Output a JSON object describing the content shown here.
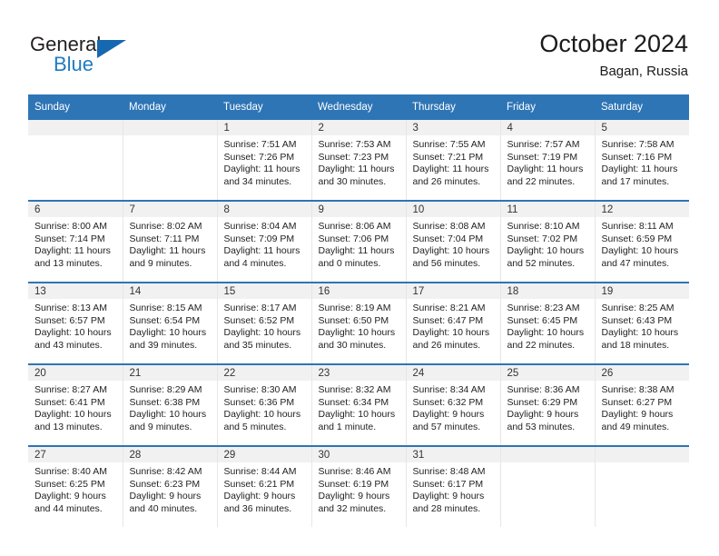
{
  "brand": {
    "name_top": "General",
    "name_bottom": "Blue",
    "accent_color": "#1668b0",
    "triangle_icon": "triangle-icon"
  },
  "header": {
    "title": "October 2024",
    "subtitle": "Bagan, Russia"
  },
  "theme": {
    "header_blue": "#2e75b6",
    "daynum_gray": "#f1f1f1",
    "text": "#222222"
  },
  "calendar": {
    "weekday_headers": [
      "Sunday",
      "Monday",
      "Tuesday",
      "Wednesday",
      "Thursday",
      "Friday",
      "Saturday"
    ],
    "labels": {
      "sunrise": "Sunrise:",
      "sunset": "Sunset:",
      "daylight": "Daylight:"
    },
    "weeks": [
      [
        {
          "day": "",
          "sunrise": "",
          "sunset": "",
          "daylight": ""
        },
        {
          "day": "",
          "sunrise": "",
          "sunset": "",
          "daylight": ""
        },
        {
          "day": "1",
          "sunrise": "Sunrise: 7:51 AM",
          "sunset": "Sunset: 7:26 PM",
          "daylight": "Daylight: 11 hours and 34 minutes."
        },
        {
          "day": "2",
          "sunrise": "Sunrise: 7:53 AM",
          "sunset": "Sunset: 7:23 PM",
          "daylight": "Daylight: 11 hours and 30 minutes."
        },
        {
          "day": "3",
          "sunrise": "Sunrise: 7:55 AM",
          "sunset": "Sunset: 7:21 PM",
          "daylight": "Daylight: 11 hours and 26 minutes."
        },
        {
          "day": "4",
          "sunrise": "Sunrise: 7:57 AM",
          "sunset": "Sunset: 7:19 PM",
          "daylight": "Daylight: 11 hours and 22 minutes."
        },
        {
          "day": "5",
          "sunrise": "Sunrise: 7:58 AM",
          "sunset": "Sunset: 7:16 PM",
          "daylight": "Daylight: 11 hours and 17 minutes."
        }
      ],
      [
        {
          "day": "6",
          "sunrise": "Sunrise: 8:00 AM",
          "sunset": "Sunset: 7:14 PM",
          "daylight": "Daylight: 11 hours and 13 minutes."
        },
        {
          "day": "7",
          "sunrise": "Sunrise: 8:02 AM",
          "sunset": "Sunset: 7:11 PM",
          "daylight": "Daylight: 11 hours and 9 minutes."
        },
        {
          "day": "8",
          "sunrise": "Sunrise: 8:04 AM",
          "sunset": "Sunset: 7:09 PM",
          "daylight": "Daylight: 11 hours and 4 minutes."
        },
        {
          "day": "9",
          "sunrise": "Sunrise: 8:06 AM",
          "sunset": "Sunset: 7:06 PM",
          "daylight": "Daylight: 11 hours and 0 minutes."
        },
        {
          "day": "10",
          "sunrise": "Sunrise: 8:08 AM",
          "sunset": "Sunset: 7:04 PM",
          "daylight": "Daylight: 10 hours and 56 minutes."
        },
        {
          "day": "11",
          "sunrise": "Sunrise: 8:10 AM",
          "sunset": "Sunset: 7:02 PM",
          "daylight": "Daylight: 10 hours and 52 minutes."
        },
        {
          "day": "12",
          "sunrise": "Sunrise: 8:11 AM",
          "sunset": "Sunset: 6:59 PM",
          "daylight": "Daylight: 10 hours and 47 minutes."
        }
      ],
      [
        {
          "day": "13",
          "sunrise": "Sunrise: 8:13 AM",
          "sunset": "Sunset: 6:57 PM",
          "daylight": "Daylight: 10 hours and 43 minutes."
        },
        {
          "day": "14",
          "sunrise": "Sunrise: 8:15 AM",
          "sunset": "Sunset: 6:54 PM",
          "daylight": "Daylight: 10 hours and 39 minutes."
        },
        {
          "day": "15",
          "sunrise": "Sunrise: 8:17 AM",
          "sunset": "Sunset: 6:52 PM",
          "daylight": "Daylight: 10 hours and 35 minutes."
        },
        {
          "day": "16",
          "sunrise": "Sunrise: 8:19 AM",
          "sunset": "Sunset: 6:50 PM",
          "daylight": "Daylight: 10 hours and 30 minutes."
        },
        {
          "day": "17",
          "sunrise": "Sunrise: 8:21 AM",
          "sunset": "Sunset: 6:47 PM",
          "daylight": "Daylight: 10 hours and 26 minutes."
        },
        {
          "day": "18",
          "sunrise": "Sunrise: 8:23 AM",
          "sunset": "Sunset: 6:45 PM",
          "daylight": "Daylight: 10 hours and 22 minutes."
        },
        {
          "day": "19",
          "sunrise": "Sunrise: 8:25 AM",
          "sunset": "Sunset: 6:43 PM",
          "daylight": "Daylight: 10 hours and 18 minutes."
        }
      ],
      [
        {
          "day": "20",
          "sunrise": "Sunrise: 8:27 AM",
          "sunset": "Sunset: 6:41 PM",
          "daylight": "Daylight: 10 hours and 13 minutes."
        },
        {
          "day": "21",
          "sunrise": "Sunrise: 8:29 AM",
          "sunset": "Sunset: 6:38 PM",
          "daylight": "Daylight: 10 hours and 9 minutes."
        },
        {
          "day": "22",
          "sunrise": "Sunrise: 8:30 AM",
          "sunset": "Sunset: 6:36 PM",
          "daylight": "Daylight: 10 hours and 5 minutes."
        },
        {
          "day": "23",
          "sunrise": "Sunrise: 8:32 AM",
          "sunset": "Sunset: 6:34 PM",
          "daylight": "Daylight: 10 hours and 1 minute."
        },
        {
          "day": "24",
          "sunrise": "Sunrise: 8:34 AM",
          "sunset": "Sunset: 6:32 PM",
          "daylight": "Daylight: 9 hours and 57 minutes."
        },
        {
          "day": "25",
          "sunrise": "Sunrise: 8:36 AM",
          "sunset": "Sunset: 6:29 PM",
          "daylight": "Daylight: 9 hours and 53 minutes."
        },
        {
          "day": "26",
          "sunrise": "Sunrise: 8:38 AM",
          "sunset": "Sunset: 6:27 PM",
          "daylight": "Daylight: 9 hours and 49 minutes."
        }
      ],
      [
        {
          "day": "27",
          "sunrise": "Sunrise: 8:40 AM",
          "sunset": "Sunset: 6:25 PM",
          "daylight": "Daylight: 9 hours and 44 minutes."
        },
        {
          "day": "28",
          "sunrise": "Sunrise: 8:42 AM",
          "sunset": "Sunset: 6:23 PM",
          "daylight": "Daylight: 9 hours and 40 minutes."
        },
        {
          "day": "29",
          "sunrise": "Sunrise: 8:44 AM",
          "sunset": "Sunset: 6:21 PM",
          "daylight": "Daylight: 9 hours and 36 minutes."
        },
        {
          "day": "30",
          "sunrise": "Sunrise: 8:46 AM",
          "sunset": "Sunset: 6:19 PM",
          "daylight": "Daylight: 9 hours and 32 minutes."
        },
        {
          "day": "31",
          "sunrise": "Sunrise: 8:48 AM",
          "sunset": "Sunset: 6:17 PM",
          "daylight": "Daylight: 9 hours and 28 minutes."
        },
        {
          "day": "",
          "sunrise": "",
          "sunset": "",
          "daylight": ""
        },
        {
          "day": "",
          "sunrise": "",
          "sunset": "",
          "daylight": ""
        }
      ]
    ]
  }
}
